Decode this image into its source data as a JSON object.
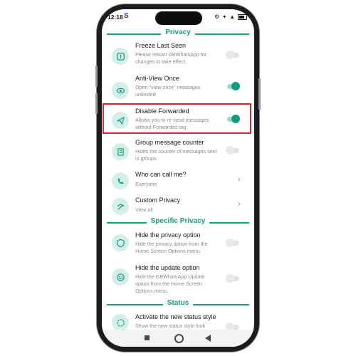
{
  "status_bar": {
    "time": "12:18",
    "carrier_letter": "S",
    "icons": "⚙ ✦ ▲"
  },
  "sections": {
    "privacy": "Privacy",
    "specific_privacy": "Specific Privacy",
    "status": "Status"
  },
  "rows": [
    {
      "title": "Freeze Last Seen",
      "desc": "Please restart GBWhatsApp for changes to take effect.",
      "control": "toggle",
      "state": "off",
      "icon": "freeze-icon"
    },
    {
      "title": "Anti-View Once",
      "desc": "Open \"view once\" messages unlimited",
      "control": "toggle",
      "state": "on",
      "icon": "eye-icon"
    },
    {
      "title": "Disable Forwarded",
      "desc": "Allows you to re-send messages without Forwarded tag",
      "control": "toggle",
      "state": "on",
      "icon": "send-icon"
    },
    {
      "title": "Group message counter",
      "desc": "Hides the counter of messages sent in groups",
      "control": "toggle",
      "state": "off",
      "icon": "counter-icon"
    },
    {
      "title": "Who can call me?",
      "desc": "Everyone",
      "control": "chevron",
      "icon": "call-icon"
    },
    {
      "title": "Custom Privacy",
      "desc": "View all",
      "control": "chevron",
      "icon": "custom-privacy-icon"
    },
    {
      "title": "Hide the privacy option",
      "desc": "Hide the privacy option from the Home Screen Options menu.",
      "control": "toggle",
      "state": "off",
      "icon": "shield-icon"
    },
    {
      "title": "Hide the update option",
      "desc": "Hide the GBWhatsApp Update option from the Home Screen Options menu.",
      "control": "toggle",
      "state": "off",
      "icon": "update-icon"
    },
    {
      "title": "Activate the new status style",
      "desc": "Show the new status style look",
      "control": "toggle",
      "state": "off",
      "icon": "status-icon"
    }
  ],
  "colors": {
    "accent": "#1a9e7e",
    "toggle_on": "#129e7d",
    "highlight": "#d62435",
    "icon_bg": "#d4efe7"
  }
}
